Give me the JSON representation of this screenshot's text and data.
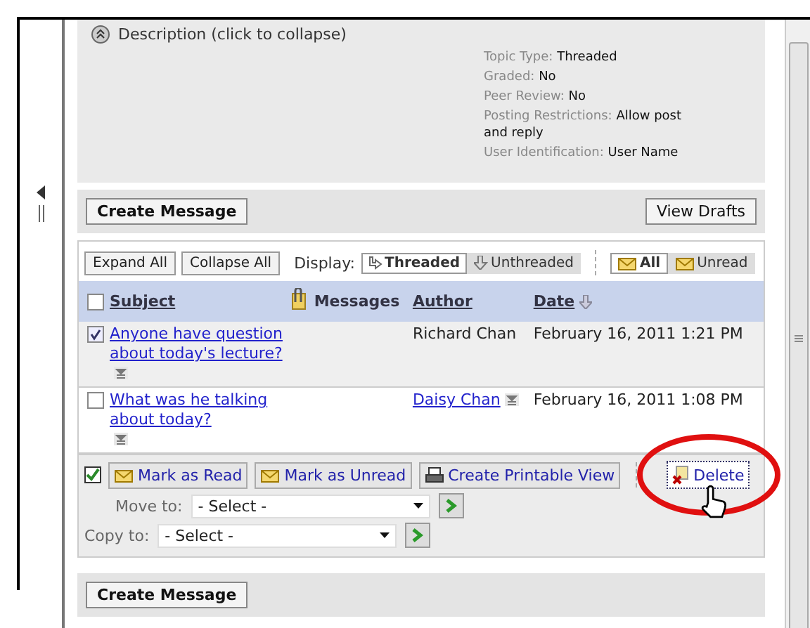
{
  "description": {
    "toggle_label": "Description (click to collapse)",
    "properties": [
      {
        "label": "Topic Type:",
        "value": "Threaded"
      },
      {
        "label": "Graded:",
        "value": "No"
      },
      {
        "label": "Peer Review:",
        "value": "No"
      },
      {
        "label": "Posting Restrictions:",
        "value": "Allow post and reply"
      },
      {
        "label": "User Identification:",
        "value": "User Name"
      }
    ]
  },
  "top_toolbar": {
    "create_button": "Create Message",
    "drafts_button": "View Drafts"
  },
  "list_toolbar": {
    "expand_button": "Expand All",
    "collapse_button": "Collapse All",
    "display_label": "Display:",
    "display_options": [
      {
        "label": "Threaded",
        "selected": true
      },
      {
        "label": "Unthreaded",
        "selected": false
      }
    ],
    "filter_options": [
      {
        "label": "All",
        "selected": true
      },
      {
        "label": "Unread",
        "selected": false
      }
    ]
  },
  "table": {
    "all_checked": false,
    "columns": [
      {
        "kind": "link",
        "label": "Subject"
      },
      {
        "kind": "attachment"
      },
      {
        "kind": "text",
        "label": "Messages"
      },
      {
        "kind": "link",
        "label": "Author"
      },
      {
        "kind": "sort",
        "label": "Date"
      }
    ],
    "rows": [
      {
        "checked": true,
        "subject": "Anyone have question about today's lecture?",
        "author": "Richard Chan",
        "author_link": false,
        "date": "February 16, 2011 1:21 PM"
      },
      {
        "checked": false,
        "subject": "What was he talking about today?",
        "author": "Daisy Chan",
        "author_link": true,
        "date": "February 16, 2011 1:08 PM"
      }
    ]
  },
  "actions": {
    "buttons": [
      {
        "kind": "read",
        "label": "Mark as Read"
      },
      {
        "kind": "unread",
        "label": "Mark as Unread"
      },
      {
        "kind": "print",
        "label": "Create Printable View"
      },
      {
        "kind": "delete",
        "label": "Delete"
      }
    ],
    "move_to": {
      "label": "Move to:",
      "value": "- Select -"
    },
    "copy_to": {
      "label": "Copy to:",
      "value": "- Select -"
    }
  },
  "bottom_toolbar": {
    "create_button": "Create Message"
  }
}
